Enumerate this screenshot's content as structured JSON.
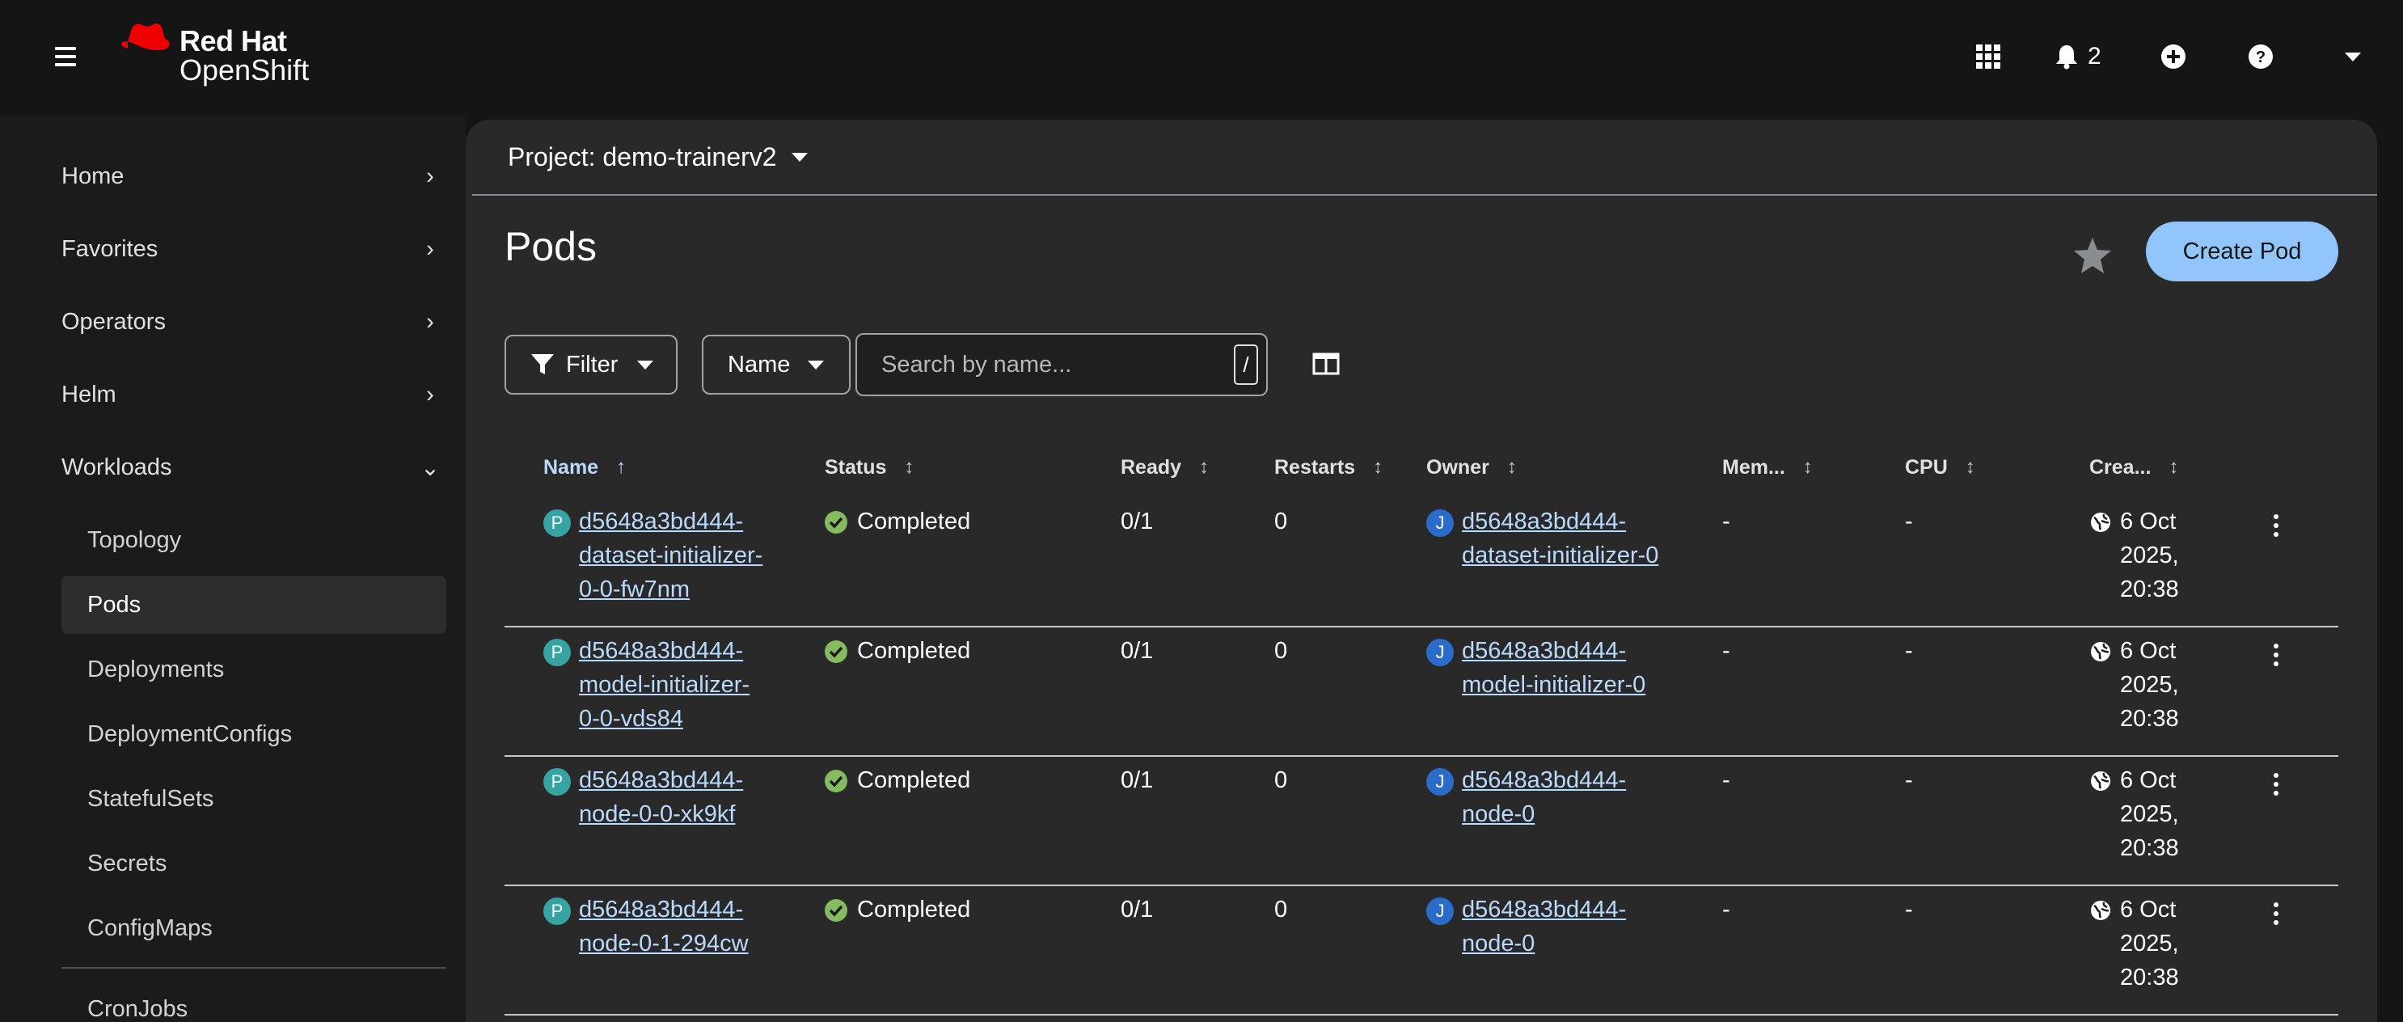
{
  "masthead": {
    "brand_line1": "Red Hat",
    "brand_line2": "OpenShift",
    "notifications_count": "2"
  },
  "sidebar": {
    "items": [
      {
        "label": "Home"
      },
      {
        "label": "Favorites"
      },
      {
        "label": "Operators"
      },
      {
        "label": "Helm"
      },
      {
        "label": "Workloads"
      }
    ],
    "workloads_sub": [
      {
        "label": "Topology"
      },
      {
        "label": "Pods"
      },
      {
        "label": "Deployments"
      },
      {
        "label": "DeploymentConfigs"
      },
      {
        "label": "StatefulSets"
      },
      {
        "label": "Secrets"
      },
      {
        "label": "ConfigMaps"
      },
      {
        "label": "CronJobs"
      }
    ]
  },
  "project": {
    "label": "Project: demo-trainerv2"
  },
  "page": {
    "title": "Pods",
    "create_label": "Create Pod"
  },
  "toolbar": {
    "filter_label": "Filter",
    "name_label": "Name",
    "search_placeholder": "Search by name...",
    "slash_hint": "/"
  },
  "table": {
    "columns": [
      "Name",
      "Status",
      "Ready",
      "Restarts",
      "Owner",
      "Mem...",
      "CPU",
      "Crea..."
    ],
    "sort_arrow_active": "↑",
    "sort_arrow": "↕",
    "pod_badge": "P",
    "job_badge": "J",
    "rows": [
      {
        "name_lines": [
          "d5648a3bd444-",
          "dataset-initializer-",
          "0-0-fw7nm"
        ],
        "status": "Completed",
        "ready": "0/1",
        "restarts": "0",
        "owner_lines": [
          "d5648a3bd444-",
          "dataset-initializer-0"
        ],
        "memory": "-",
        "cpu": "-",
        "created_lines": [
          "6 Oct",
          "2025,",
          "20:38"
        ]
      },
      {
        "name_lines": [
          "d5648a3bd444-",
          "model-initializer-",
          "0-0-vds84"
        ],
        "status": "Completed",
        "ready": "0/1",
        "restarts": "0",
        "owner_lines": [
          "d5648a3bd444-",
          "model-initializer-0"
        ],
        "memory": "-",
        "cpu": "-",
        "created_lines": [
          "6 Oct",
          "2025,",
          "20:38"
        ]
      },
      {
        "name_lines": [
          "d5648a3bd444-",
          "node-0-0-xk9kf"
        ],
        "status": "Completed",
        "ready": "0/1",
        "restarts": "0",
        "owner_lines": [
          "d5648a3bd444-",
          "node-0"
        ],
        "memory": "-",
        "cpu": "-",
        "created_lines": [
          "6 Oct",
          "2025,",
          "20:38"
        ]
      },
      {
        "name_lines": [
          "d5648a3bd444-",
          "node-0-1-294cw"
        ],
        "status": "Completed",
        "ready": "0/1",
        "restarts": "0",
        "owner_lines": [
          "d5648a3bd444-",
          "node-0"
        ],
        "memory": "-",
        "cpu": "-",
        "created_lines": [
          "6 Oct",
          "2025,",
          "20:38"
        ]
      }
    ]
  },
  "colors": {
    "accent": "#92c5f9",
    "link": "#b9dafc",
    "success": "#87bb62",
    "pod_badge": "#37a3a3",
    "job_badge": "#2b6cc9"
  }
}
